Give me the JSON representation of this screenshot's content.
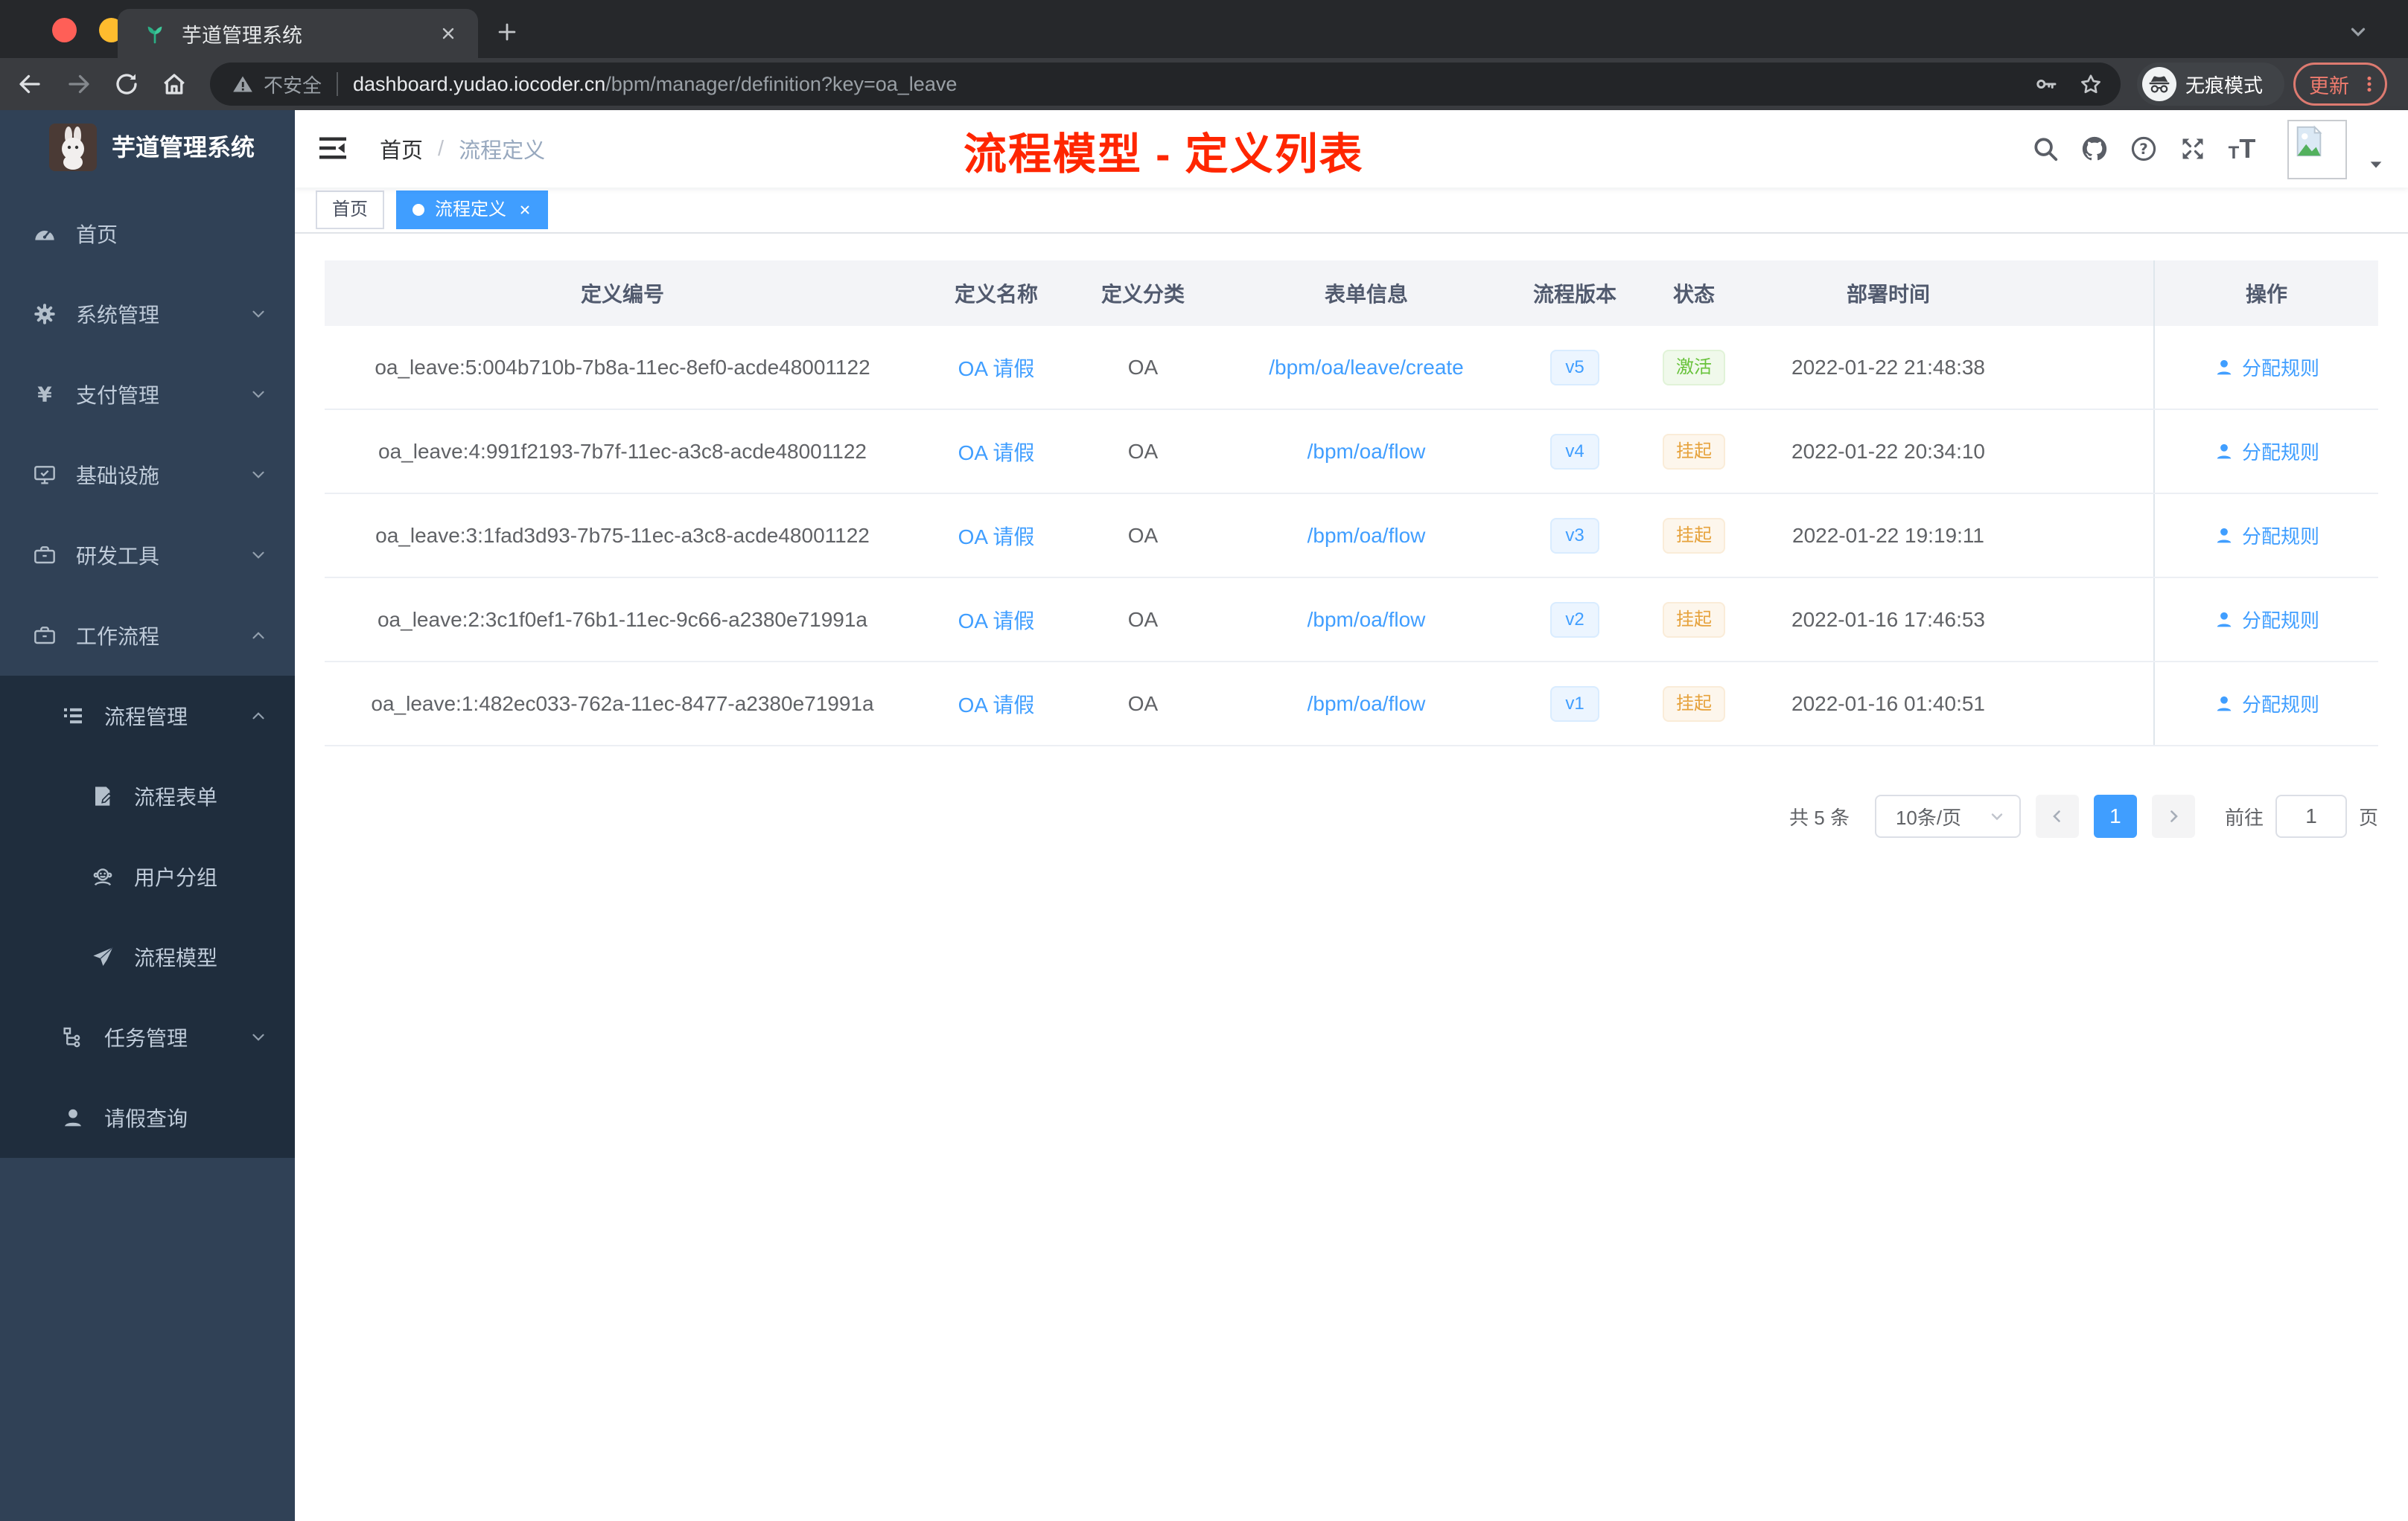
{
  "browser": {
    "tab_title": "芋道管理系统",
    "security_label": "不安全",
    "url_domain": "dashboard.yudao.iocoder.cn",
    "url_path": "/bpm/manager/definition?key=oa_leave",
    "incognito_label": "无痕模式",
    "update_label": "更新"
  },
  "sidebar": {
    "app_title": "芋道管理系统",
    "items": [
      {
        "label": "首页",
        "icon": "dashboard",
        "level": 1,
        "chevron": "",
        "dark": false
      },
      {
        "label": "系统管理",
        "icon": "gear",
        "level": 1,
        "chevron": "down",
        "dark": false
      },
      {
        "label": "支付管理",
        "icon": "yen",
        "level": 1,
        "chevron": "down",
        "dark": false
      },
      {
        "label": "基础设施",
        "icon": "monitor",
        "level": 1,
        "chevron": "down",
        "dark": false
      },
      {
        "label": "研发工具",
        "icon": "toolbox",
        "level": 1,
        "chevron": "down",
        "dark": false
      },
      {
        "label": "工作流程",
        "icon": "toolbox",
        "level": 1,
        "chevron": "up",
        "dark": false
      },
      {
        "label": "流程管理",
        "icon": "outline",
        "level": 2,
        "chevron": "up",
        "dark": true
      },
      {
        "label": "流程表单",
        "icon": "form",
        "level": 3,
        "chevron": "",
        "dark": true
      },
      {
        "label": "用户分组",
        "icon": "group",
        "level": 3,
        "chevron": "",
        "dark": true
      },
      {
        "label": "流程模型",
        "icon": "plane",
        "level": 3,
        "chevron": "",
        "dark": true
      },
      {
        "label": "任务管理",
        "icon": "tree",
        "level": 2,
        "chevron": "down",
        "dark": true
      },
      {
        "label": "请假查询",
        "icon": "user",
        "level": 2,
        "chevron": "",
        "dark": true
      }
    ]
  },
  "header": {
    "breadcrumb_home": "首页",
    "breadcrumb_sep": "/",
    "breadcrumb_current": "流程定义",
    "icons": [
      "search",
      "github",
      "help",
      "fullscreen",
      "fontsize"
    ]
  },
  "annotation": "流程模型 - 定义列表",
  "tags": [
    {
      "label": "首页",
      "active": false
    },
    {
      "label": "流程定义",
      "active": true
    }
  ],
  "table": {
    "columns": [
      "定义编号",
      "定义名称",
      "定义分类",
      "表单信息",
      "流程版本",
      "状态",
      "部署时间",
      "操作"
    ],
    "rows": [
      {
        "id": "oa_leave:5:004b710b-7b8a-11ec-8ef0-acde48001122",
        "name": "OA 请假",
        "category": "OA",
        "form": "/bpm/oa/leave/create",
        "version": "v5",
        "status": "激活",
        "status_type": "success",
        "time": "2022-01-22 21:48:38",
        "action": "分配规则"
      },
      {
        "id": "oa_leave:4:991f2193-7b7f-11ec-a3c8-acde48001122",
        "name": "OA 请假",
        "category": "OA",
        "form": "/bpm/oa/flow",
        "version": "v4",
        "status": "挂起",
        "status_type": "warning",
        "time": "2022-01-22 20:34:10",
        "action": "分配规则"
      },
      {
        "id": "oa_leave:3:1fad3d93-7b75-11ec-a3c8-acde48001122",
        "name": "OA 请假",
        "category": "OA",
        "form": "/bpm/oa/flow",
        "version": "v3",
        "status": "挂起",
        "status_type": "warning",
        "time": "2022-01-22 19:19:11",
        "action": "分配规则"
      },
      {
        "id": "oa_leave:2:3c1f0ef1-76b1-11ec-9c66-a2380e71991a",
        "name": "OA 请假",
        "category": "OA",
        "form": "/bpm/oa/flow",
        "version": "v2",
        "status": "挂起",
        "status_type": "warning",
        "time": "2022-01-16 17:46:53",
        "action": "分配规则"
      },
      {
        "id": "oa_leave:1:482ec033-762a-11ec-8477-a2380e71991a",
        "name": "OA 请假",
        "category": "OA",
        "form": "/bpm/oa/flow",
        "version": "v1",
        "status": "挂起",
        "status_type": "warning",
        "time": "2022-01-16 01:40:51",
        "action": "分配规则"
      }
    ]
  },
  "pagination": {
    "total_label": "共 5 条",
    "page_size_label": "10条/页",
    "current_page": "1",
    "goto_label": "前往",
    "goto_value": "1",
    "page_unit_label": "页"
  }
}
